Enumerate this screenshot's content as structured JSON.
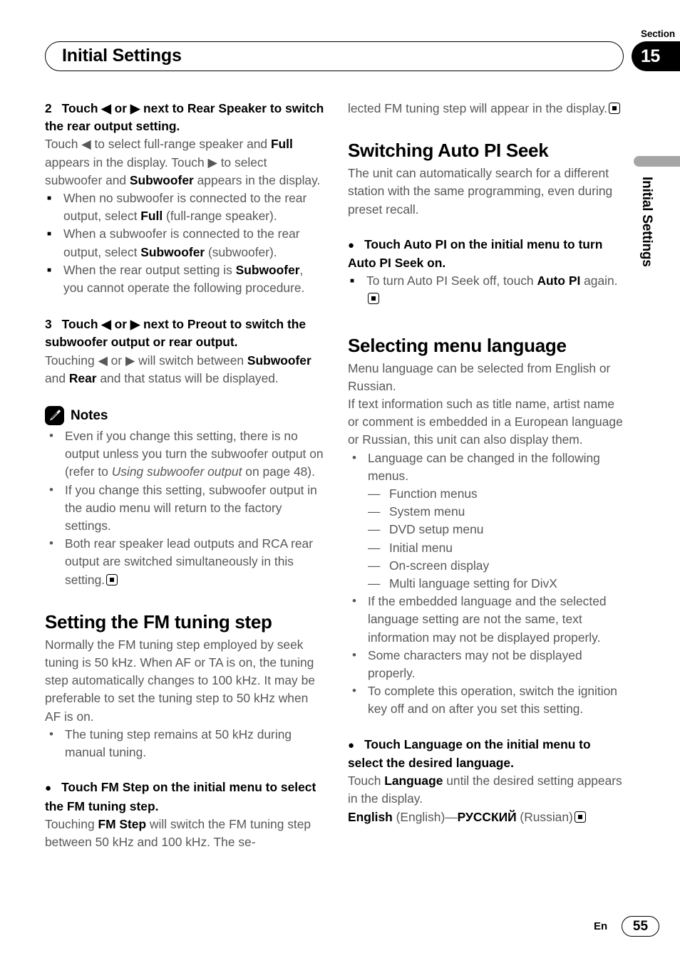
{
  "header": {
    "title": "Initial Settings",
    "section_word": "Section",
    "section_number": "15"
  },
  "side_tab": {
    "label": "Initial Settings"
  },
  "footer": {
    "language_code": "En",
    "page_number": "55"
  },
  "left_column": {
    "step2": {
      "number": "2",
      "heading_a": "Touch ",
      "heading_left_arrow": "◀",
      "heading_b": " or ",
      "heading_right_arrow": "▶",
      "heading_c": " next to Rear Speaker to switch the rear output setting.",
      "body_1": "Touch ",
      "body_arrow_l": "◀",
      "body_2": " to select full-range speaker and ",
      "body_full": "Full",
      "body_3": " appears in the display. Touch ",
      "body_arrow_r": "▶",
      "body_4": " to select subwoofer and ",
      "body_sub": "Subwoofer",
      "body_5": " appears in the display."
    },
    "step2_notes": [
      {
        "pre": "When no subwoofer is connected to the rear output, select ",
        "bold": "Full",
        "post": " (full-range speaker)."
      },
      {
        "pre": "When a subwoofer is connected to the rear output, select ",
        "bold": "Subwoofer",
        "post": " (subwoofer)."
      },
      {
        "pre": "When the rear output setting is ",
        "bold": "Subwoofer",
        "post": ", you cannot operate the following procedure."
      }
    ],
    "step3": {
      "number": "3",
      "heading_a": "Touch ",
      "heading_left_arrow": "◀",
      "heading_b": " or ",
      "heading_right_arrow": "▶",
      "heading_c": " next to Preout to switch the subwoofer output or rear output.",
      "body_1": "Touching ",
      "body_arrow_l": "◀",
      "body_2": " or ",
      "body_arrow_r": "▶",
      "body_3": " will switch between ",
      "body_sub": "Subwoofer",
      "body_4": " and ",
      "body_rear": "Rear",
      "body_5": " and that status will be displayed."
    },
    "notes_label": "Notes",
    "notes_items": [
      {
        "pre": "Even if you change this setting, there is no output unless you turn the subwoofer output on (refer to ",
        "italic": "Using subwoofer output",
        "post": " on page 48).",
        "endmark": false
      },
      {
        "pre": "If you change this setting, subwoofer output in the audio menu will return to the factory settings.",
        "italic": "",
        "post": "",
        "endmark": false
      },
      {
        "pre": "Both rear speaker lead outputs and RCA rear output are switched simultaneously in this setting.",
        "italic": "",
        "post": "",
        "endmark": true
      }
    ],
    "fm_heading": "Setting the FM tuning step",
    "fm_body": "Normally the FM tuning step employed by seek tuning is 50 kHz. When AF or TA is on, the tuning step automatically changes to 100 kHz. It may be preferable to set the tuning step to 50 kHz when AF is on.",
    "fm_note": "The tuning step remains at 50 kHz during manual tuning.",
    "fm_step": {
      "dot": "●",
      "heading": "Touch FM Step on the initial menu to select the FM tuning step.",
      "body_1": "Touching ",
      "body_bold": "FM Step",
      "body_2": " will switch the FM tuning step between 50 kHz and 100 kHz. The se-"
    }
  },
  "right_column": {
    "continued_text": "lected FM tuning step will appear in the display.",
    "pi_heading": "Switching Auto PI Seek",
    "pi_body": "The unit can automatically search for a different station with the same programming, even during preset recall.",
    "pi_step": {
      "dot": "●",
      "heading": "Touch Auto PI on the initial menu to turn Auto PI Seek on."
    },
    "pi_note": {
      "pre": "To turn Auto PI Seek off, touch ",
      "bold": "Auto PI",
      "post": " again."
    },
    "lang_heading": "Selecting menu language",
    "lang_body_1": "Menu language can be selected from English or Russian.",
    "lang_body_2": "If text information such as title name, artist name or comment is embedded in a European language or Russian, this unit can also display them.",
    "lang_bullet_1": "Language can be changed in the following menus.",
    "lang_menus": [
      "Function menus",
      "System menu",
      "DVD setup menu",
      "Initial menu",
      "On-screen display",
      "Multi language setting for DivX"
    ],
    "lang_bullets": [
      "If the embedded language and the selected language setting are not the same, text information may not be displayed properly.",
      "Some characters may not be displayed properly.",
      "To complete this operation, switch the ignition key off and on after you set this setting."
    ],
    "lang_step": {
      "dot": "●",
      "heading": "Touch Language on the initial menu to select the desired language.",
      "body_1": "Touch ",
      "body_bold": "Language",
      "body_2": " until the desired setting appears in the display."
    },
    "lang_values": {
      "english_bold": "English",
      "english_paren": " (English)—",
      "russian_bold": "РУССКИЙ",
      "russian_paren": " (Russian)"
    },
    "dash": "—"
  }
}
